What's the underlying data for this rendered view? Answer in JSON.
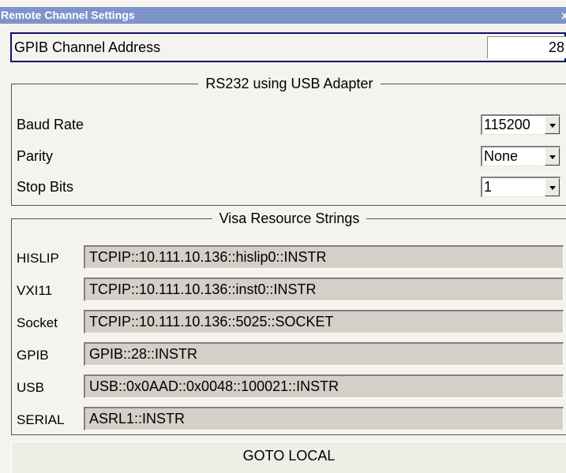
{
  "window": {
    "title": "Remote Channel Settings",
    "close_glyph": "x"
  },
  "gpib": {
    "label": "GPIB Channel Address",
    "value": "28"
  },
  "rs232": {
    "title": "RS232 using USB Adapter",
    "rows": [
      {
        "label": "Baud Rate",
        "value": "115200"
      },
      {
        "label": "Parity",
        "value": "None"
      },
      {
        "label": "Stop Bits",
        "value": "1"
      }
    ]
  },
  "visa": {
    "title": "Visa Resource Strings",
    "rows": [
      {
        "label": "HISLIP",
        "value": "TCPIP::10.111.10.136::hislip0::INSTR"
      },
      {
        "label": "VXI11",
        "value": "TCPIP::10.111.10.136::inst0::INSTR"
      },
      {
        "label": "Socket",
        "value": "TCPIP::10.111.10.136::5025::SOCKET"
      },
      {
        "label": "GPIB",
        "value": "GPIB::28::INSTR"
      },
      {
        "label": "USB",
        "value": "USB::0x0AAD::0x0048::100021::INSTR"
      },
      {
        "label": "SERIAL",
        "value": "ASRL1::INSTR"
      }
    ]
  },
  "goto_local": {
    "label": "GOTO LOCAL"
  },
  "icons": {
    "combo_arrow": "chevron-down-icon",
    "close": "close-icon"
  }
}
